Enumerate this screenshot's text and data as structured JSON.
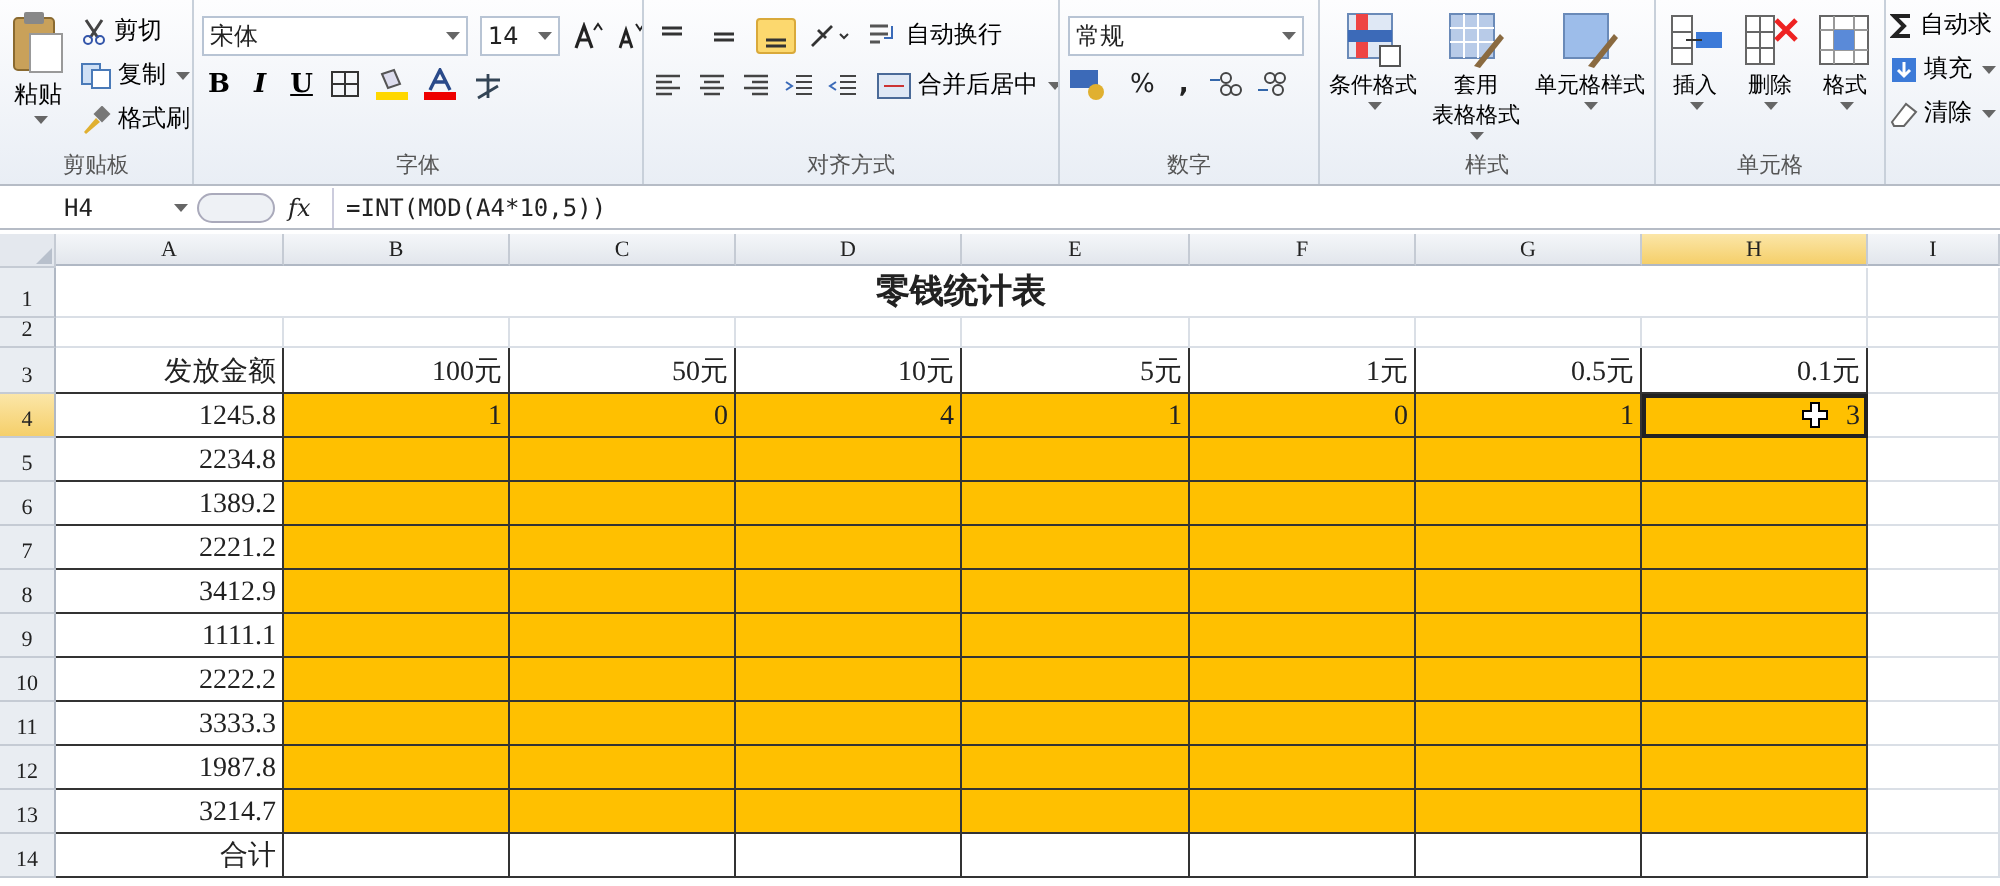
{
  "ribbon": {
    "clipboard": {
      "label": "剪贴板",
      "paste": "粘贴",
      "items": [
        {
          "kind": "cut",
          "label": "剪切"
        },
        {
          "kind": "copy",
          "label": "复制"
        },
        {
          "kind": "brush",
          "label": "格式刷"
        }
      ]
    },
    "font": {
      "label": "字体",
      "font_name": "宋体",
      "font_size": "14",
      "styles": [
        "B",
        "I",
        "U"
      ]
    },
    "alignment": {
      "label": "对齐方式",
      "vertical": [
        {
          "selected": false
        },
        {
          "selected": false
        },
        {
          "selected": true
        }
      ],
      "wrap": "自动换行",
      "merge": "合并后居中"
    },
    "number": {
      "label": "数字",
      "format": "常规",
      "percent": "%",
      "comma": ","
    },
    "styles": {
      "label": "样式",
      "buttons": [
        {
          "kind": "conditional",
          "lines": [
            "条件格式"
          ]
        },
        {
          "kind": "table",
          "lines": [
            "套用",
            "表格格式"
          ]
        },
        {
          "kind": "cell",
          "lines": [
            "单元格样式"
          ]
        }
      ]
    },
    "cells": {
      "label": "单元格",
      "buttons": [
        {
          "kind": "insert",
          "label": "插入"
        },
        {
          "kind": "delete",
          "label": "删除"
        },
        {
          "kind": "format",
          "label": "格式"
        }
      ]
    },
    "editing": {
      "items": [
        {
          "kind": "sum",
          "label": "自动求"
        },
        {
          "kind": "fill",
          "label": "填充"
        },
        {
          "kind": "clear",
          "label": "清除"
        }
      ]
    }
  },
  "formula_bar": {
    "name_box": "H4",
    "fx": "fx",
    "formula": "=INT(MOD(A4*10,5))"
  },
  "columns": [
    {
      "label": "A",
      "selected": false
    },
    {
      "label": "B",
      "selected": false
    },
    {
      "label": "C",
      "selected": false
    },
    {
      "label": "D",
      "selected": false
    },
    {
      "label": "E",
      "selected": false
    },
    {
      "label": "F",
      "selected": false
    },
    {
      "label": "G",
      "selected": false
    },
    {
      "label": "H",
      "selected": true
    },
    {
      "label": "I",
      "selected": false
    }
  ],
  "title": "零钱统计表",
  "rows": [
    {
      "number": "1",
      "kind": "title",
      "selected": false,
      "cells": []
    },
    {
      "number": "2",
      "kind": "blank",
      "selected": false,
      "cells": []
    },
    {
      "number": "3",
      "kind": "header",
      "selected": false,
      "cells": [
        "发放金额",
        "100元",
        "50元",
        "10元",
        "5元",
        "1元",
        "0.5元",
        "0.1元"
      ]
    },
    {
      "number": "4",
      "kind": "data",
      "selected": true,
      "cells": [
        "1245.8",
        "1",
        "0",
        "4",
        "1",
        "0",
        "1",
        "3"
      ]
    },
    {
      "number": "5",
      "kind": "data",
      "selected": false,
      "cells": [
        "2234.8"
      ]
    },
    {
      "number": "6",
      "kind": "data",
      "selected": false,
      "cells": [
        "1389.2"
      ]
    },
    {
      "number": "7",
      "kind": "data",
      "selected": false,
      "cells": [
        "2221.2"
      ]
    },
    {
      "number": "8",
      "kind": "data",
      "selected": false,
      "cells": [
        "3412.9"
      ]
    },
    {
      "number": "9",
      "kind": "data",
      "selected": false,
      "cells": [
        "1111.1"
      ]
    },
    {
      "number": "10",
      "kind": "data",
      "selected": false,
      "cells": [
        "2222.2"
      ]
    },
    {
      "number": "11",
      "kind": "data",
      "selected": false,
      "cells": [
        "3333.3"
      ]
    },
    {
      "number": "12",
      "kind": "data",
      "selected": false,
      "cells": [
        "1987.8"
      ]
    },
    {
      "number": "13",
      "kind": "data",
      "selected": false,
      "cells": [
        "3214.7"
      ]
    },
    {
      "number": "14",
      "kind": "total",
      "selected": false,
      "cells": [
        "合计"
      ]
    }
  ]
}
